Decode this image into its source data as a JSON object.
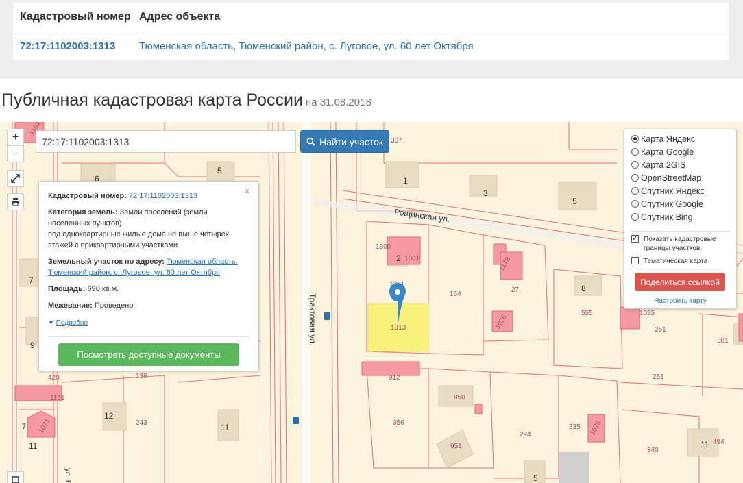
{
  "table": {
    "headers": [
      "Кадастровый номер",
      "Адрес объекта"
    ],
    "row": {
      "cadastral_number": "72:17:1102003:1313",
      "address": "Тюменская область, Тюменский район, с. Луговое, ул. 60 лет Октября"
    }
  },
  "page": {
    "title": "Публичная кадастровая карта России",
    "date": "на 31.08.2018"
  },
  "map": {
    "search_value": "72:17:1102003:1313",
    "search_button": "Найти участок",
    "controls": {
      "zoom_in": "+",
      "zoom_out": "−"
    },
    "labels": {
      "street_roshchinskaya": "Рощинская ул.",
      "street_traktovaya": "Трактовая ул.",
      "street_bottom": "ул. Б",
      "n1": "1",
      "n3": "3",
      "n5a": "5",
      "n5b": "5",
      "n6": "6",
      "n7a": "7",
      "n7b": "7",
      "n8": "8",
      "n9": "9",
      "n11a": "11",
      "n11b": "11",
      "n11c": "11",
      "n12": "12",
      "n2": "2",
      "p307": "307",
      "p1300": "1300",
      "p1301": "1301",
      "p1001": "1001",
      "p154": "154",
      "p27": "27",
      "p1313": "1313",
      "p555": "555",
      "p251a": "251",
      "p251b": "251",
      "p381": "381",
      "p420": "420",
      "p138": "138",
      "p1161": "1161",
      "p243": "243",
      "p912": "912",
      "p950": "950",
      "p356": "356",
      "p951": "951",
      "p294": "294",
      "p335": "335",
      "p340": "340",
      "p494": "494",
      "p1071": "1071",
      "p1025": "1025",
      "p1101": "1101",
      "p1178": "1178",
      "p1076": "1076",
      "p1026": "1026"
    }
  },
  "popup": {
    "close": "×",
    "cadastral_label": "Кадастровый номер:",
    "cadastral_value": "72:17:1102003:1313",
    "category_label": "Категория земель:",
    "category_value": "Земли поселений (земли населенных пунктов)",
    "usage": "под одноквартирные жилые дома не выше четырех этажей с приквартирными участками",
    "address_label": "Земельный участок по адресу:",
    "address_value": "Тюменская область, Тюменский район, с. Луговое, ул. 60 лет Октября",
    "area_label": "Площадь:",
    "area_value": "690 кв.м.",
    "survey_label": "Межевание:",
    "survey_value": "Проведено",
    "more": "Подробно",
    "docs_button": "Посмотреть доступные документы"
  },
  "layers": {
    "options": [
      "Карта Яндекс",
      "Карта Google",
      "Карта 2GIS",
      "OpenStreetMap",
      "Спутник Яндекс",
      "Спутник Google",
      "Спутник Bing"
    ],
    "selected": 0,
    "show_borders": "Показать кадастровые границы участков",
    "thematic": "Тематическая карта",
    "share_button": "Поделиться ссылкой",
    "configure": "Настроить карту"
  },
  "colors": {
    "link": "#2a6fb0",
    "primary": "#337ab7",
    "success": "#5cb85c",
    "danger": "#d9534f",
    "parcel": "#e0707a",
    "selected_parcel": "#f7f07a"
  }
}
